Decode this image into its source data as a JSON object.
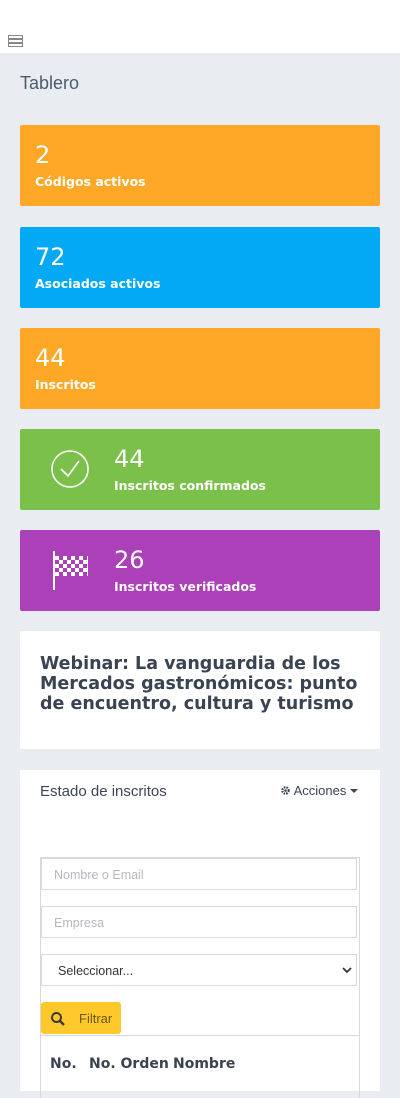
{
  "page": {
    "title": "Tablero"
  },
  "stats": [
    {
      "value": "2",
      "label": "Códigos activos",
      "color": "#ffa726"
    },
    {
      "value": "72",
      "label": "Asociados activos",
      "color": "#03a9f4"
    },
    {
      "value": "44",
      "label": "Inscritos",
      "color": "#ffa726"
    },
    {
      "value": "44",
      "label": "Inscritos confirmados",
      "color": "#7bc04a",
      "icon": "check-circle-icon"
    },
    {
      "value": "26",
      "label": "Inscritos verificados",
      "color": "#ab40b8",
      "icon": "checkered-flag-icon"
    }
  ],
  "event": {
    "title": "Webinar: La vanguardia de los Mercados gastronómicos: punto de encuentro, cultura y turismo"
  },
  "estado": {
    "title": "Estado de inscritos",
    "actions_label": "Acciones",
    "name_placeholder": "Nombre o Email",
    "company_placeholder": "Empresa",
    "select_value": "Seleccionar...",
    "filter_label": "Filtrar",
    "columns": [
      "No.",
      "No. Orden",
      "Nombre"
    ]
  }
}
